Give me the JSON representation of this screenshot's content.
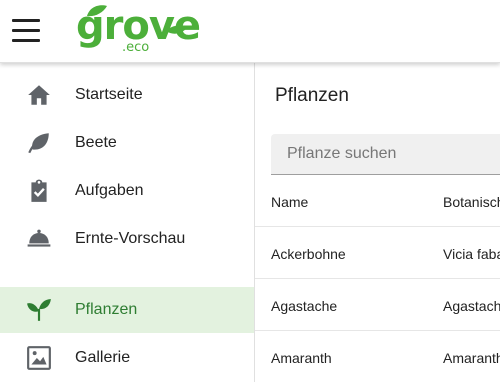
{
  "app": {
    "logo_text": "grove",
    "logo_sub": ".eco",
    "brand_color": "#4caf3a",
    "active_bg": "#e3f2df"
  },
  "sidebar": {
    "items": [
      {
        "label": "Startseite",
        "icon": "home-icon"
      },
      {
        "label": "Beete",
        "icon": "leaf-icon"
      },
      {
        "label": "Aufgaben",
        "icon": "clipboard-check-icon"
      },
      {
        "label": "Ernte-Vorschau",
        "icon": "harvest-cloche-icon"
      },
      {
        "label": "Pflanzen",
        "icon": "sprout-icon",
        "active": true
      },
      {
        "label": "Gallerie",
        "icon": "gallery-image-icon"
      }
    ]
  },
  "main": {
    "title": "Pflanzen",
    "search": {
      "placeholder": "Pflanze suchen",
      "value": ""
    },
    "table": {
      "columns": [
        "Name",
        "Botanisch"
      ],
      "rows": [
        [
          "Ackerbohne",
          "Vicia faba"
        ],
        [
          "Agastache",
          "Agastache"
        ],
        [
          "Amaranth",
          "Amaranth"
        ]
      ]
    }
  }
}
